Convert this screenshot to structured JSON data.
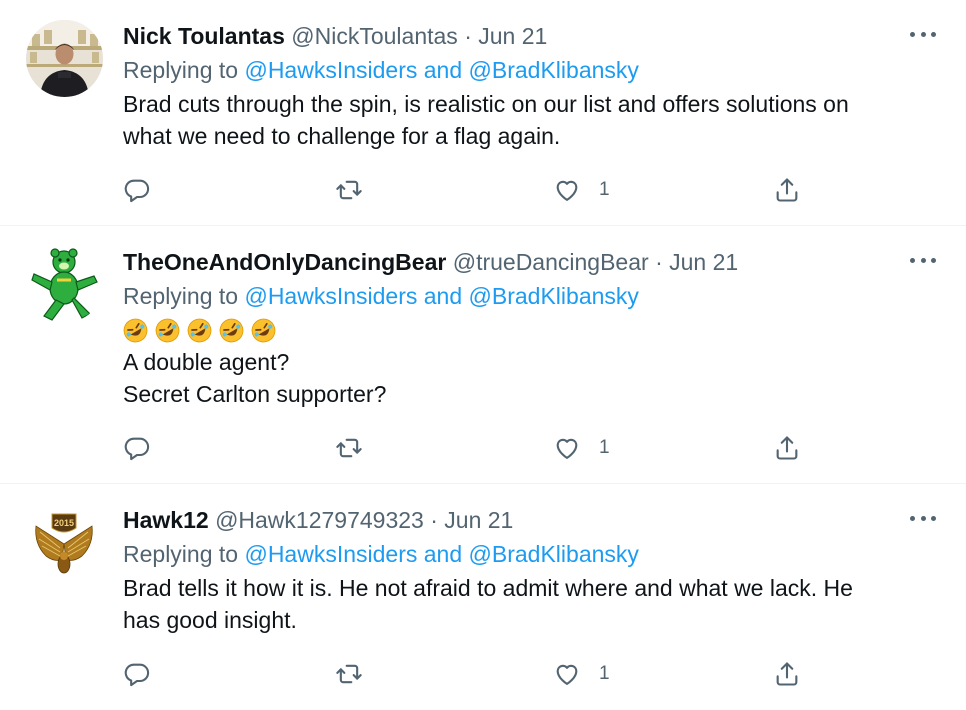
{
  "tweets": [
    {
      "name": "Nick Toulantas",
      "handle": "@NickToulantas",
      "sep": "·",
      "date": "Jun 21",
      "replying_prefix": "Replying to",
      "mention1": "@HawksInsiders",
      "and": "and",
      "mention2": "@BradKlibansky",
      "lines": [
        "Brad cuts through the spin, is realistic on our list and offers solutions on",
        "what we need to challenge for a flag again."
      ],
      "likes": "1"
    },
    {
      "name": "TheOneAndOnlyDancingBear",
      "handle": "@trueDancingBear",
      "sep": "·",
      "date": "Jun 21",
      "replying_prefix": "Replying to",
      "mention1": "@HawksInsiders",
      "and": "and",
      "mention2": "@BradKlibansky",
      "emoji_count": 5,
      "emoji": "rolling-on-floor-laughing-emoji",
      "lines": [
        "A double agent?",
        "Secret Carlton supporter?"
      ],
      "likes": "1"
    },
    {
      "name": "Hawk12",
      "handle": "@Hawk1279749323",
      "sep": "·",
      "date": "Jun 21",
      "replying_prefix": "Replying to",
      "mention1": "@HawksInsiders",
      "and": "and",
      "mention2": "@BradKlibansky",
      "lines": [
        "Brad tells it how it is. He not afraid to admit where and what we lack. He",
        "has good insight."
      ],
      "likes": "1",
      "avatar_text": "2015"
    }
  ],
  "colors": {
    "link": "#1d9bf0",
    "muted": "#536471",
    "text": "#0f1419",
    "divider": "#eff3f4"
  },
  "icons": {
    "reply": "reply-icon",
    "retweet": "retweet-icon",
    "like": "heart-icon",
    "share": "share-icon",
    "more": "more-icon"
  }
}
